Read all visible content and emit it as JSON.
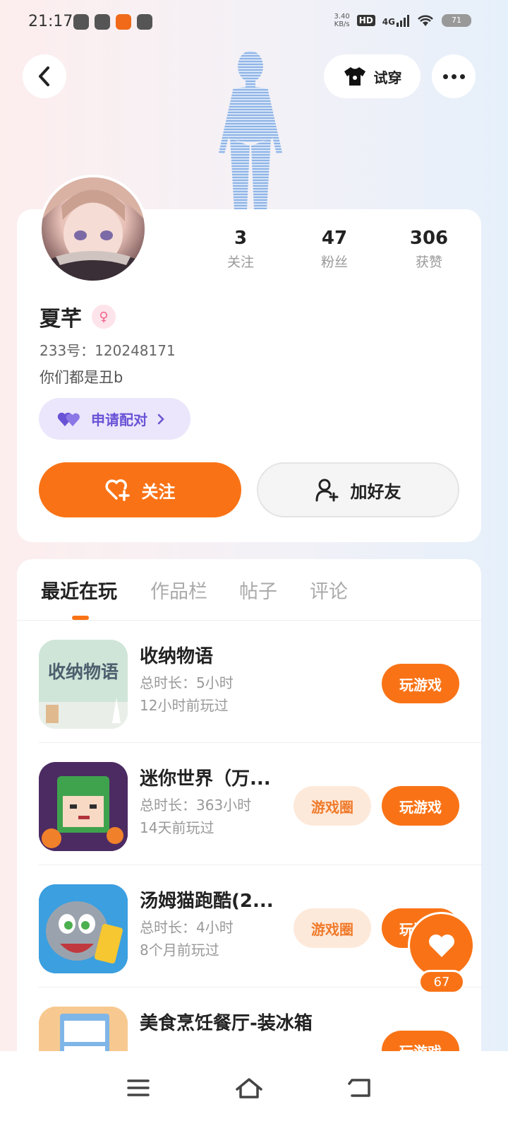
{
  "status_bar": {
    "time": "21:17",
    "speed_value": "3.40",
    "speed_unit": "KB/s",
    "hd": "HD",
    "network": "4G",
    "battery": "71"
  },
  "header": {
    "tryon_label": "试穿"
  },
  "profile": {
    "stats": [
      {
        "value": "3",
        "label": "关注"
      },
      {
        "value": "47",
        "label": "粉丝"
      },
      {
        "value": "306",
        "label": "获赞"
      }
    ],
    "nickname": "夏芊",
    "uid": "233号：120248171",
    "bio": "你们都是丑b",
    "match_label": "申请配对",
    "follow_label": "关注",
    "add_friend_label": "加好友"
  },
  "tabs": [
    {
      "label": "最近在玩",
      "active": true
    },
    {
      "label": "作品栏",
      "active": false
    },
    {
      "label": "帖子",
      "active": false
    },
    {
      "label": "评论",
      "active": false
    }
  ],
  "games": [
    {
      "title": "收纳物语",
      "duration": "总时长：5小时",
      "last_played": "12小时前玩过",
      "circle_label": "",
      "play_label": "玩游戏",
      "icon_text": "收纳物语"
    },
    {
      "title": "迷你世界（万...",
      "duration": "总时长：363小时",
      "last_played": "14天前玩过",
      "circle_label": "游戏圈",
      "play_label": "玩游戏",
      "icon_text": ""
    },
    {
      "title": "汤姆猫跑酷(2...",
      "duration": "总时长：4小时",
      "last_played": "8个月前玩过",
      "circle_label": "游戏圈",
      "play_label": "玩游戏",
      "icon_text": ""
    },
    {
      "title": "美食烹饪餐厅-装冰箱",
      "duration": "",
      "last_played": "",
      "circle_label": "",
      "play_label": "玩游戏",
      "icon_text": ""
    }
  ],
  "like_fab": {
    "count": "67"
  },
  "colors": {
    "accent": "#f97316",
    "match_purple": "#6a52d6",
    "circle_bg": "#fde9da"
  }
}
